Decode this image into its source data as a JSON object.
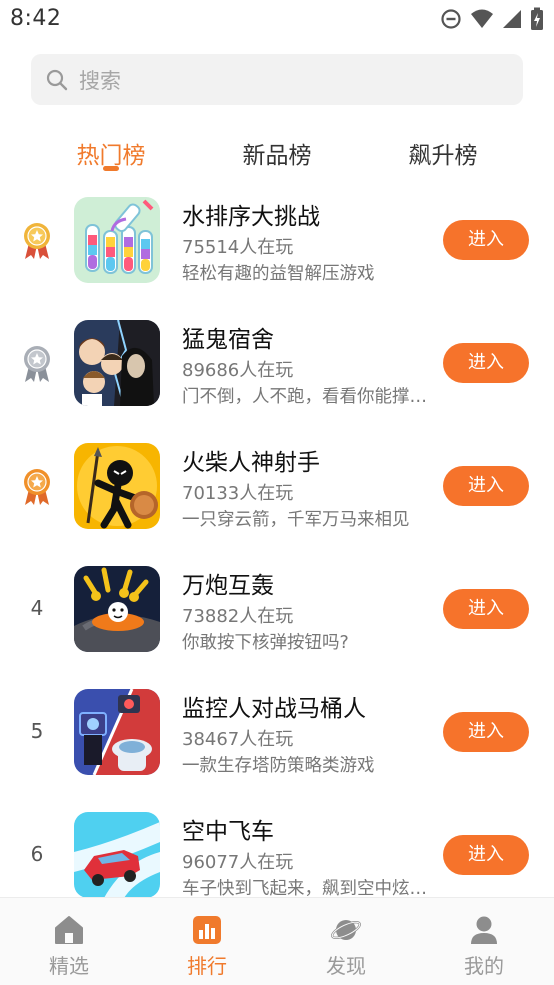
{
  "status_bar": {
    "time": "8:42",
    "icons": [
      "dnd-icon",
      "wifi-icon",
      "signal-icon",
      "battery-icon"
    ]
  },
  "search": {
    "placeholder": "搜索"
  },
  "tabs": [
    {
      "label": "热门榜",
      "active": true
    },
    {
      "label": "新品榜",
      "active": false
    },
    {
      "label": "飙升榜",
      "active": false
    }
  ],
  "games": [
    {
      "rank": "1",
      "medal": "gold",
      "name": "水排序大挑战",
      "players": "75514人在玩",
      "desc": "轻松有趣的益智解压游戏",
      "button": "进入"
    },
    {
      "rank": "2",
      "medal": "silver",
      "name": "猛鬼宿舍",
      "players": "89686人在玩",
      "desc": " 门不倒，人不跑，看看你能撑过几晚",
      "button": "进入"
    },
    {
      "rank": "3",
      "medal": "bronze",
      "name": "火柴人神射手",
      "players": "70133人在玩",
      "desc": "一只穿云箭，千军万马来相见",
      "button": "进入"
    },
    {
      "rank": "4",
      "medal": "",
      "name": "万炮互轰",
      "players": "73882人在玩",
      "desc": "你敢按下核弹按钮吗?",
      "button": "进入"
    },
    {
      "rank": "5",
      "medal": "",
      "name": "监控人对战马桶人",
      "players": "38467人在玩",
      "desc": "一款生存塔防策略类游戏",
      "button": "进入"
    },
    {
      "rank": "6",
      "medal": "",
      "name": "空中飞车",
      "players": "96077人在玩",
      "desc": "车子快到飞起来，飙到空中炫技吧",
      "button": "进入"
    }
  ],
  "bottom_nav": [
    {
      "label": "精选",
      "icon": "home-icon",
      "active": false
    },
    {
      "label": "排行",
      "icon": "ranking-icon",
      "active": true
    },
    {
      "label": "发现",
      "icon": "planet-icon",
      "active": false
    },
    {
      "label": "我的",
      "icon": "profile-icon",
      "active": false
    }
  ],
  "colors": {
    "accent": "#f07a2c",
    "button": "#f6732b",
    "gold": "#f0b43a",
    "silver": "#a9aeb6",
    "bronze": "#f0902a"
  }
}
